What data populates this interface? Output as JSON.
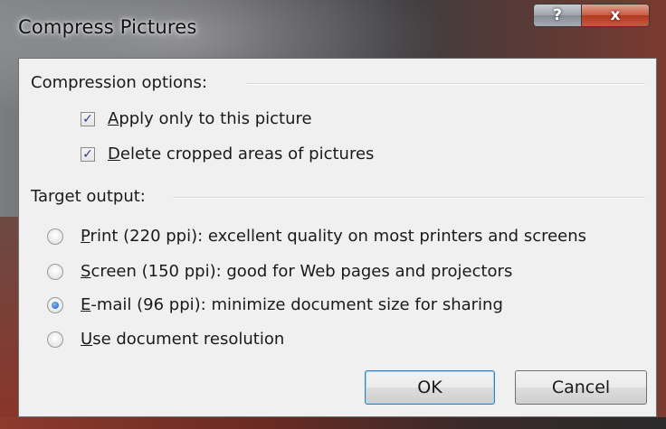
{
  "window": {
    "title": "Compress Pictures",
    "help_label": "?",
    "close_label": "x"
  },
  "compression": {
    "label": "Compression options:",
    "options": [
      {
        "pre": "",
        "key": "A",
        "rest": "pply only to this picture",
        "checked": true
      },
      {
        "pre": "",
        "key": "D",
        "rest": "elete cropped areas of pictures",
        "checked": true
      }
    ]
  },
  "target": {
    "label": "Target output:",
    "options": [
      {
        "key": "P",
        "rest": "rint (220 ppi): excellent quality on most printers and screens",
        "selected": false
      },
      {
        "key": "S",
        "rest": "creen (150 ppi): good for Web pages and projectors",
        "selected": false
      },
      {
        "key": "E",
        "rest": "-mail (96 ppi): minimize document size for sharing",
        "selected": true
      },
      {
        "key": "U",
        "rest": "se document resolution",
        "selected": false
      }
    ]
  },
  "buttons": {
    "ok": "OK",
    "cancel": "Cancel"
  },
  "check_glyph": "✓"
}
